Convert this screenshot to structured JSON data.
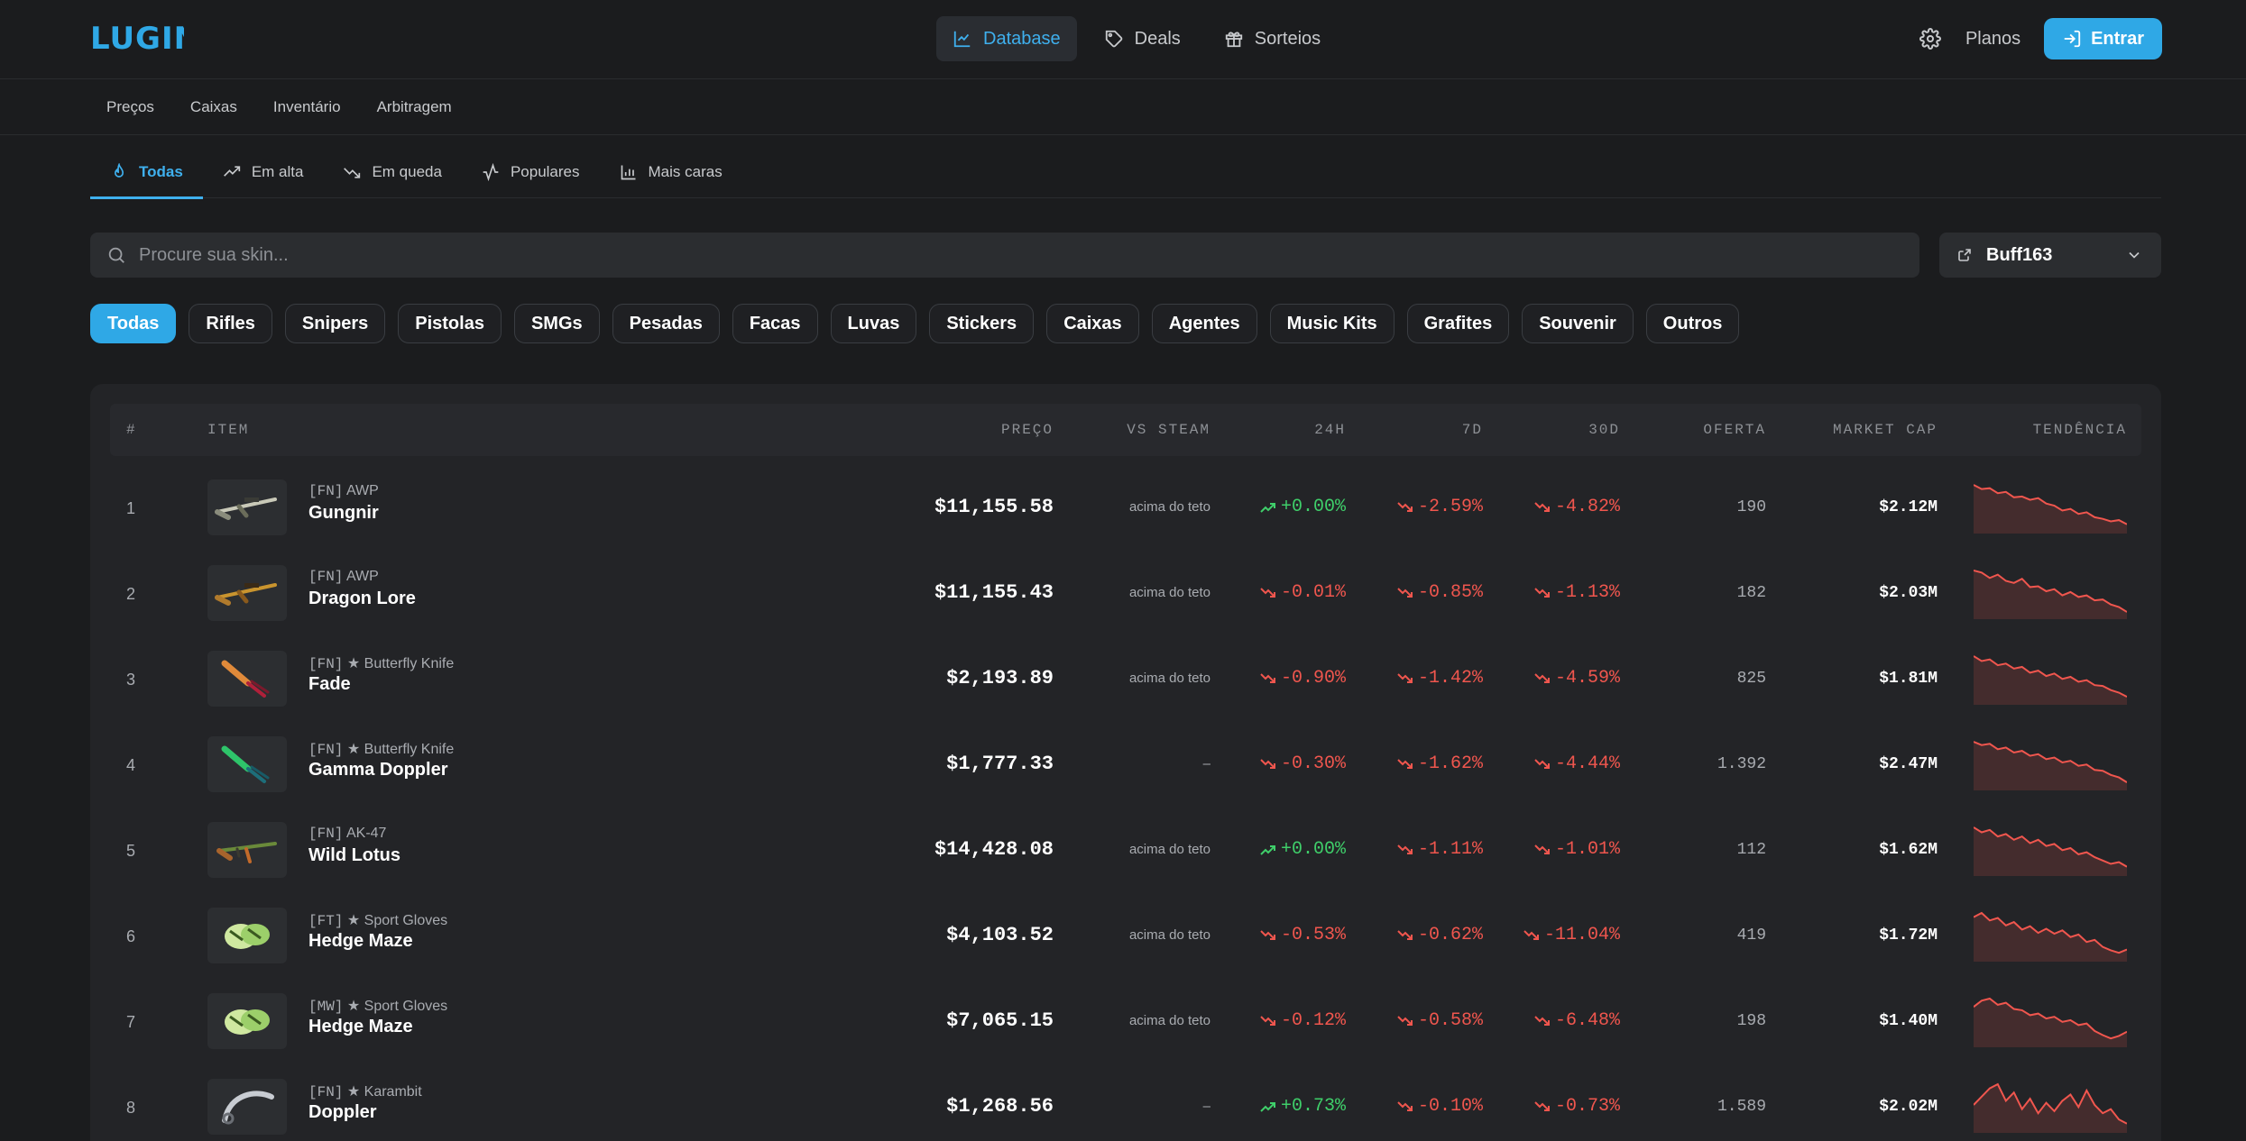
{
  "brand": {
    "logo": "LUGIN",
    "accent": "#2fa8e6"
  },
  "nav": {
    "items": [
      {
        "label": "Database",
        "icon": "chart-line-icon",
        "active": true
      },
      {
        "label": "Deals",
        "icon": "tag-icon",
        "active": false
      },
      {
        "label": "Sorteios",
        "icon": "gift-icon",
        "active": false
      }
    ],
    "planos": "Planos",
    "entrar": "Entrar"
  },
  "subnav": [
    "Preços",
    "Caixas",
    "Inventário",
    "Arbitragem"
  ],
  "tabs": [
    {
      "label": "Todas",
      "icon": "flame-icon",
      "active": true
    },
    {
      "label": "Em alta",
      "icon": "trending-up-icon",
      "active": false
    },
    {
      "label": "Em queda",
      "icon": "trending-down-icon",
      "active": false
    },
    {
      "label": "Populares",
      "icon": "activity-icon",
      "active": false
    },
    {
      "label": "Mais caras",
      "icon": "bar-chart-icon",
      "active": false
    }
  ],
  "search": {
    "placeholder": "Procure sua skin...",
    "value": ""
  },
  "market": {
    "selected": "Buff163"
  },
  "chips": [
    "Todas",
    "Rifles",
    "Snipers",
    "Pistolas",
    "SMGs",
    "Pesadas",
    "Facas",
    "Luvas",
    "Stickers",
    "Caixas",
    "Agentes",
    "Music Kits",
    "Grafites",
    "Souvenir",
    "Outros"
  ],
  "table": {
    "headers": {
      "num": "#",
      "item": "ITEM",
      "price": "PREÇO",
      "vs": "VS STEAM",
      "h24": "24H",
      "d7": "7D",
      "d30": "30D",
      "oferta": "OFERTA",
      "mcap": "MARKET CAP",
      "trend": "TENDÊNCIA"
    },
    "rows": [
      {
        "n": "1",
        "cond": "[FN]",
        "type": "AWP",
        "name": "Gungnir",
        "price": "$11,155.58",
        "vs": "acima do teto",
        "h24": "+0.00%",
        "h24dir": "up",
        "d7": "-2.59%",
        "d7dir": "down",
        "d30": "-4.82%",
        "d30dir": "down",
        "oferta": "190",
        "mcap": "$2.12M",
        "icon": "awp-icon",
        "trend": [
          1.0,
          0.9,
          0.92,
          0.8,
          0.83,
          0.7,
          0.72,
          0.64,
          0.68,
          0.55,
          0.5,
          0.38,
          0.42,
          0.3,
          0.34,
          0.22,
          0.18,
          0.12,
          0.15,
          0.05
        ]
      },
      {
        "n": "2",
        "cond": "[FN]",
        "type": "AWP",
        "name": "Dragon Lore",
        "price": "$11,155.43",
        "vs": "acima do teto",
        "h24": "-0.01%",
        "h24dir": "down",
        "d7": "-0.85%",
        "d7dir": "down",
        "d30": "-1.13%",
        "d30dir": "down",
        "oferta": "182",
        "mcap": "$2.03M",
        "icon": "awp-gold-icon",
        "trend": [
          1.0,
          0.95,
          0.82,
          0.9,
          0.75,
          0.7,
          0.8,
          0.6,
          0.62,
          0.5,
          0.55,
          0.4,
          0.48,
          0.36,
          0.4,
          0.28,
          0.3,
          0.18,
          0.12,
          0.0
        ]
      },
      {
        "n": "3",
        "cond": "[FN]",
        "type": "★ Butterfly Knife",
        "name": "Fade",
        "price": "$2,193.89",
        "vs": "acima do teto",
        "h24": "-0.90%",
        "h24dir": "down",
        "d7": "-1.42%",
        "d7dir": "down",
        "d30": "-4.59%",
        "d30dir": "down",
        "oferta": "825",
        "mcap": "$1.81M",
        "icon": "knife-fade-icon",
        "trend": [
          1.0,
          0.88,
          0.92,
          0.78,
          0.82,
          0.7,
          0.74,
          0.6,
          0.65,
          0.52,
          0.58,
          0.45,
          0.5,
          0.38,
          0.42,
          0.3,
          0.28,
          0.18,
          0.12,
          0.02
        ]
      },
      {
        "n": "4",
        "cond": "[FN]",
        "type": "★ Butterfly Knife",
        "name": "Gamma Doppler",
        "price": "$1,777.33",
        "vs": "–",
        "h24": "-0.30%",
        "h24dir": "down",
        "d7": "-1.62%",
        "d7dir": "down",
        "d30": "-4.44%",
        "d30dir": "down",
        "oferta": "1.392",
        "mcap": "$2.47M",
        "icon": "knife-gamma-icon",
        "trend": [
          1.0,
          0.92,
          0.95,
          0.82,
          0.86,
          0.74,
          0.78,
          0.66,
          0.7,
          0.58,
          0.62,
          0.5,
          0.54,
          0.42,
          0.45,
          0.32,
          0.3,
          0.2,
          0.14,
          0.02
        ]
      },
      {
        "n": "5",
        "cond": "[FN]",
        "type": "AK-47",
        "name": "Wild Lotus",
        "price": "$14,428.08",
        "vs": "acima do teto",
        "h24": "+0.00%",
        "h24dir": "up",
        "d7": "-1.11%",
        "d7dir": "down",
        "d30": "-1.01%",
        "d30dir": "down",
        "oferta": "112",
        "mcap": "$1.62M",
        "icon": "ak47-icon",
        "trend": [
          1.0,
          0.88,
          0.94,
          0.78,
          0.84,
          0.7,
          0.78,
          0.62,
          0.7,
          0.55,
          0.6,
          0.45,
          0.5,
          0.35,
          0.4,
          0.28,
          0.2,
          0.12,
          0.16,
          0.05
        ]
      },
      {
        "n": "6",
        "cond": "[FT]",
        "type": "★ Sport Gloves",
        "name": "Hedge Maze",
        "price": "$4,103.52",
        "vs": "acima do teto",
        "h24": "-0.53%",
        "h24dir": "down",
        "d7": "-0.62%",
        "d7dir": "down",
        "d30": "-11.04%",
        "d30dir": "down",
        "oferta": "419",
        "mcap": "$1.72M",
        "icon": "gloves-icon",
        "trend": [
          0.9,
          1.0,
          0.82,
          0.88,
          0.7,
          0.78,
          0.6,
          0.68,
          0.52,
          0.62,
          0.5,
          0.58,
          0.42,
          0.48,
          0.3,
          0.35,
          0.18,
          0.1,
          0.04,
          0.12
        ]
      },
      {
        "n": "7",
        "cond": "[MW]",
        "type": "★ Sport Gloves",
        "name": "Hedge Maze",
        "price": "$7,065.15",
        "vs": "acima do teto",
        "h24": "-0.12%",
        "h24dir": "down",
        "d7": "-0.58%",
        "d7dir": "down",
        "d30": "-6.48%",
        "d30dir": "down",
        "oferta": "198",
        "mcap": "$1.40M",
        "icon": "gloves-icon",
        "trend": [
          0.8,
          0.95,
          1.0,
          0.85,
          0.9,
          0.75,
          0.72,
          0.6,
          0.64,
          0.52,
          0.56,
          0.44,
          0.48,
          0.36,
          0.4,
          0.22,
          0.12,
          0.04,
          0.1,
          0.2
        ]
      },
      {
        "n": "8",
        "cond": "[FN]",
        "type": "★ Karambit",
        "name": "Doppler",
        "price": "$1,268.56",
        "vs": "–",
        "h24": "+0.73%",
        "h24dir": "up",
        "d7": "-0.10%",
        "d7dir": "down",
        "d30": "-0.73%",
        "d30dir": "down",
        "oferta": "1.589",
        "mcap": "$2.02M",
        "icon": "karambit-icon",
        "trend": [
          0.5,
          0.7,
          0.9,
          1.0,
          0.6,
          0.8,
          0.4,
          0.65,
          0.3,
          0.55,
          0.35,
          0.6,
          0.75,
          0.45,
          0.85,
          0.5,
          0.3,
          0.4,
          0.15,
          0.05
        ]
      }
    ]
  }
}
